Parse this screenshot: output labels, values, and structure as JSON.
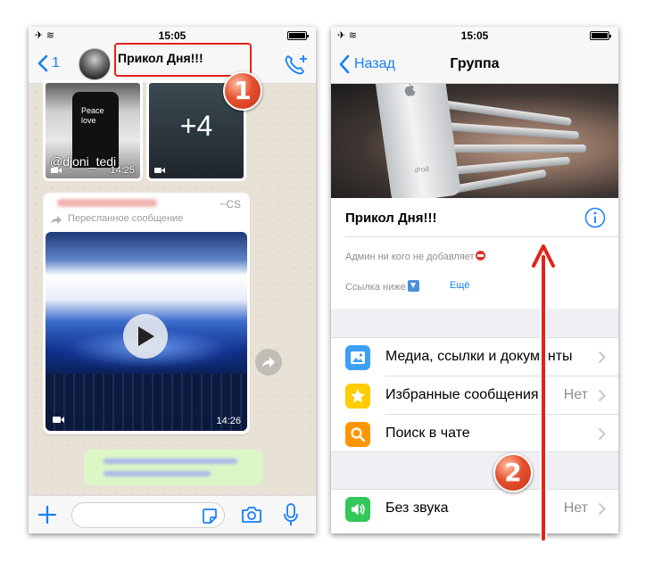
{
  "status_bar": {
    "time": "15:05"
  },
  "left_screen": {
    "nav": {
      "back_count": "1",
      "chat_title": "Прикол Дня!!!"
    },
    "media_tiles": [
      {
        "caption": "Peace\nlove",
        "handle": "@djoni_tedi",
        "time": "14:25"
      },
      {
        "overlay": "+4"
      }
    ],
    "forwarded_message": {
      "sender_suffix": "~CS",
      "forward_label": "Пересланное сообщение",
      "video_time": "14:26"
    },
    "input": {
      "placeholder": ""
    }
  },
  "right_screen": {
    "nav": {
      "back_label": "Назад",
      "title": "Группа"
    },
    "photo": {
      "device_text": "iPod"
    },
    "group_info": {
      "name": "Прикол Дня!!!",
      "description_line1": "Админ ни кого не добавляет",
      "description_line2": "Ссылка ниже",
      "more_link": "Ещё"
    },
    "settings_rows": [
      {
        "label": "Медиа, ссылки и документы",
        "value": "",
        "icon": "photo-icon",
        "color": "#3d9ff6"
      },
      {
        "label": "Избранные сообщения",
        "value": "Нет",
        "icon": "star-icon",
        "color": "#ffcc00"
      },
      {
        "label": "Поиск в чате",
        "value": "",
        "icon": "search-icon",
        "color": "#ff9500"
      },
      {
        "label": "Без звука",
        "value": "Нет",
        "icon": "speaker-icon",
        "color": "#34c759"
      }
    ]
  },
  "annotations": {
    "step_1": "1",
    "step_2": "2"
  },
  "colors": {
    "ios_blue": "#157efb",
    "annotation_red": "#e2231a",
    "chat_wallpaper": "#e8e2d6",
    "outgoing_bubble": "#dcf6c6"
  }
}
